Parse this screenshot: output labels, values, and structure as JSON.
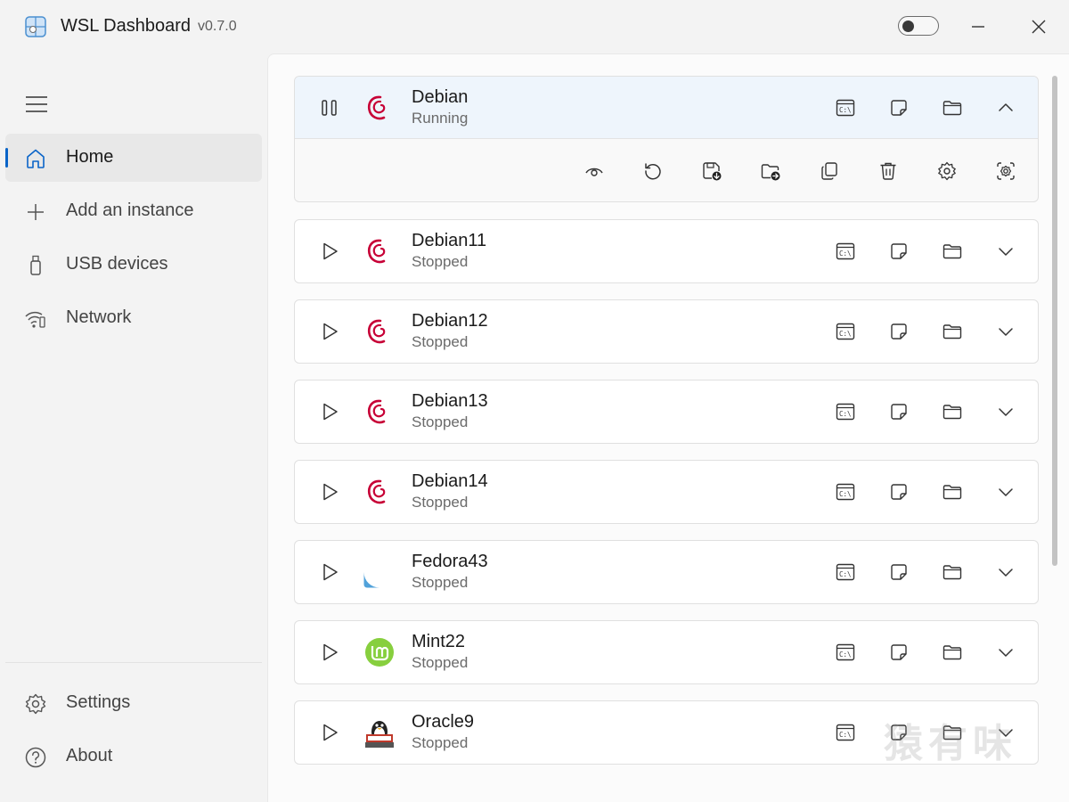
{
  "app": {
    "title": "WSL Dashboard",
    "version": "v0.7.0"
  },
  "sidebar": {
    "items": [
      {
        "label": "Home",
        "icon": "home-icon",
        "active": true
      },
      {
        "label": "Add an instance",
        "icon": "plus-icon"
      },
      {
        "label": "USB devices",
        "icon": "usb-icon"
      },
      {
        "label": "Network",
        "icon": "network-icon"
      }
    ],
    "footer": [
      {
        "label": "Settings",
        "icon": "gear-icon"
      },
      {
        "label": "About",
        "icon": "help-icon"
      }
    ]
  },
  "instances": [
    {
      "name": "Debian",
      "status": "Running",
      "logo": "debian-logo",
      "expanded": true
    },
    {
      "name": "Debian11",
      "status": "Stopped",
      "logo": "debian-logo"
    },
    {
      "name": "Debian12",
      "status": "Stopped",
      "logo": "debian-logo"
    },
    {
      "name": "Debian13",
      "status": "Stopped",
      "logo": "debian-logo"
    },
    {
      "name": "Debian14",
      "status": "Stopped",
      "logo": "debian-logo"
    },
    {
      "name": "Fedora43",
      "status": "Stopped",
      "logo": "fedora-logo"
    },
    {
      "name": "Mint22",
      "status": "Stopped",
      "logo": "mint-logo"
    },
    {
      "name": "Oracle9",
      "status": "Stopped",
      "logo": "oracle-linux-logo"
    }
  ],
  "colors": {
    "accent": "#0a64c8",
    "debian": "#c70036",
    "fedora": "#51a2da",
    "mint": "#87cf3e"
  },
  "watermark": "猿有味"
}
